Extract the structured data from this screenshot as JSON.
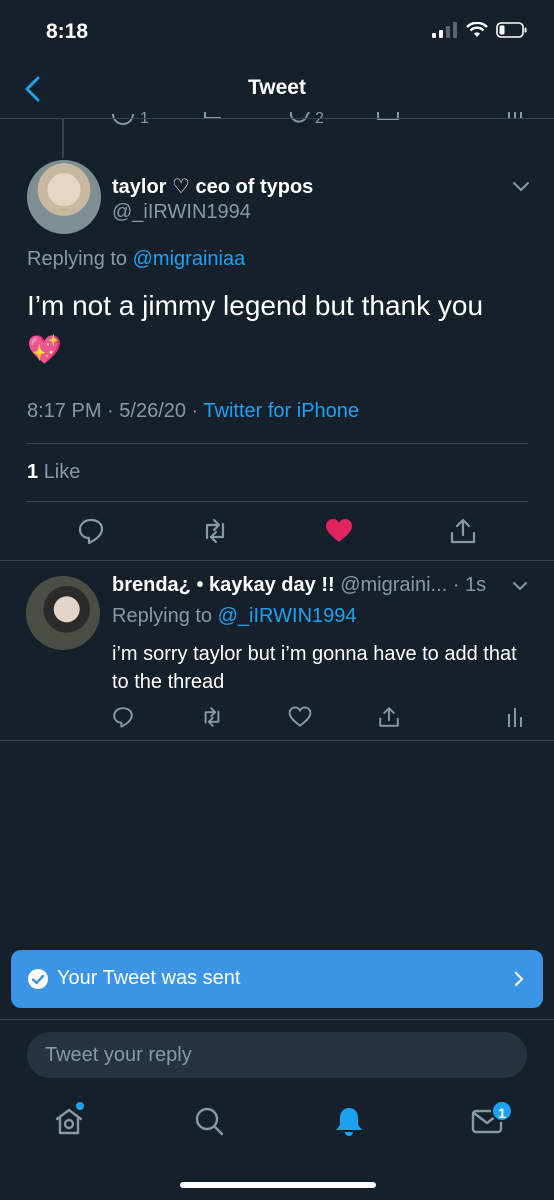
{
  "status_bar": {
    "time": "8:18"
  },
  "nav": {
    "title": "Tweet"
  },
  "peek_counts": {
    "replies": "1",
    "likes": "2"
  },
  "main_tweet": {
    "author_name": "taylor ♡ ceo of typos",
    "handle": "@_iIRWIN1994",
    "replying_prefix": "Replying to ",
    "replying_handle": "@migrainiaa",
    "text": "I’m not a jimmy legend but thank you",
    "emoji": "💖",
    "time": "8:17 PM",
    "date": "5/26/20",
    "source": "Twitter for iPhone",
    "like_count": "1",
    "like_label": "Like"
  },
  "reply_tweet": {
    "author_name": "brenda¿ • kaykay day !!",
    "handle_time": "@migraini... · 1s",
    "replying_prefix": "Replying to ",
    "replying_handle": "@_iIRWIN1994",
    "text": "i’m sorry taylor but i’m gonna have to add that to the thread"
  },
  "toast": {
    "text": "Your Tweet was sent"
  },
  "reply_bar": {
    "placeholder": "Tweet your reply"
  },
  "tab_bar": {
    "messages_badge": "1"
  },
  "colors": {
    "background": "#15202b",
    "accent": "#1da1f2",
    "muted": "#8899a6",
    "like_red": "#e0245e",
    "toast": "#3b94e4"
  }
}
